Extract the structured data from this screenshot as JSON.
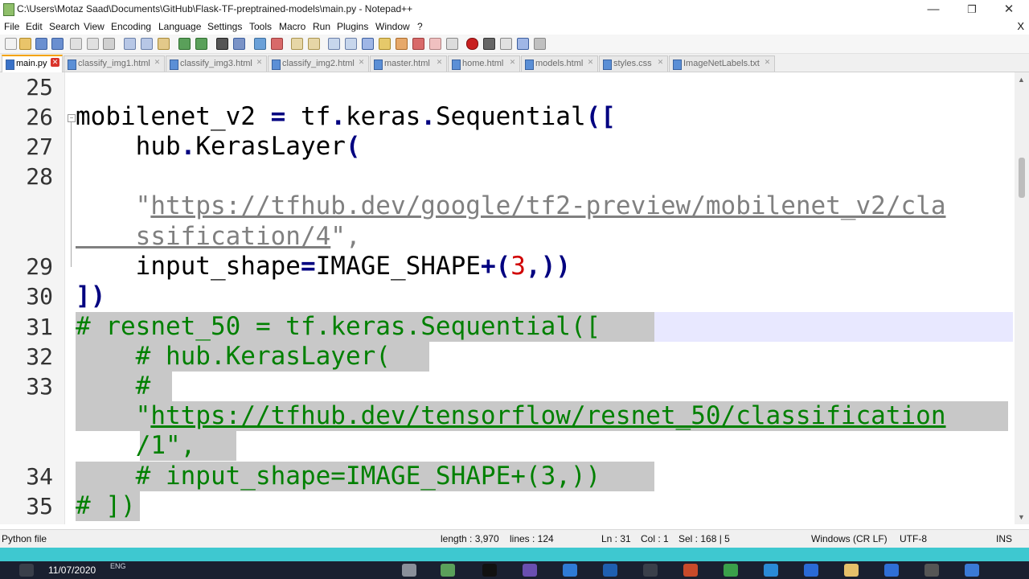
{
  "window": {
    "title": "C:\\Users\\Motaz Saad\\Documents\\GitHub\\Flask-TF-preptrained-models\\main.py - Notepad++",
    "minimize": "—",
    "restore": "❐",
    "close": "✕"
  },
  "menu": {
    "items": [
      "File",
      "Edit",
      "Search",
      "View",
      "Encoding",
      "Language",
      "Settings",
      "Tools",
      "Macro",
      "Run",
      "Plugins",
      "Window",
      "?"
    ],
    "close_doc": "X"
  },
  "tabs": [
    {
      "label": "main.py",
      "active": true
    },
    {
      "label": "classify_img1.html",
      "active": false
    },
    {
      "label": "classify_img3.html",
      "active": false
    },
    {
      "label": "classify_img2.html",
      "active": false
    },
    {
      "label": "master.html",
      "active": false
    },
    {
      "label": "home.html",
      "active": false
    },
    {
      "label": "models.html",
      "active": false
    },
    {
      "label": "styles.css",
      "active": false
    },
    {
      "label": "ImageNetLabels.txt",
      "active": false
    }
  ],
  "editor": {
    "line_numbers": [
      "25",
      "26",
      "27",
      "28",
      "29",
      "30",
      "31",
      "32",
      "33",
      "34",
      "35"
    ],
    "code": {
      "l26_a": "mobilenet_v2 ",
      "l26_b": "=",
      "l26_c": " tf",
      "l26_d": ".",
      "l26_e": "keras",
      "l26_f": ".",
      "l26_g": "Sequential",
      "l26_h": "([",
      "l27_a": "    hub",
      "l27_b": ".",
      "l27_c": "KerasLayer",
      "l27_d": "(",
      "l28a_q": "    \"",
      "l28a_url": "https://tfhub.dev/google/tf2-preview/mobilenet_v2/cla",
      "l28b_url": "    ssification/4",
      "l28b_end": "\",",
      "l29_a": "    input_shape",
      "l29_b": "=",
      "l29_c": "IMAGE_SHAPE",
      "l29_d": "+(",
      "l29_e": "3",
      "l29_f": ",))",
      "l30": "])",
      "l31": "# resnet_50 = tf.keras.Sequential([",
      "l32": "    # hub.KerasLayer(",
      "l33a": "    #",
      "l33b_q": "    \"",
      "l33b_url": "https://tfhub.dev/tensorflow/resnet_50/classification",
      "l33c": "    /1\",",
      "l34": "    # input_shape=IMAGE_SHAPE+(3,))",
      "l35": "# ])"
    }
  },
  "status": {
    "file_type": "Python file",
    "length": "length : 3,970",
    "lines": "lines : 124",
    "ln": "Ln : 31",
    "col": "Col : 1",
    "sel": "Sel : 168 | 5",
    "eol": "Windows (CR LF)",
    "encoding": "UTF-8",
    "ins": "INS"
  },
  "taskbar": {
    "lang": "ENG",
    "date": "11/07/2020"
  },
  "colors": {
    "accent_tab": "#f4a300",
    "comment": "#008000",
    "operator": "#000080",
    "number": "#d00000",
    "string": "#808080",
    "selection": "#c8c8c8",
    "taskbar_cyan": "#3ec8d0"
  }
}
